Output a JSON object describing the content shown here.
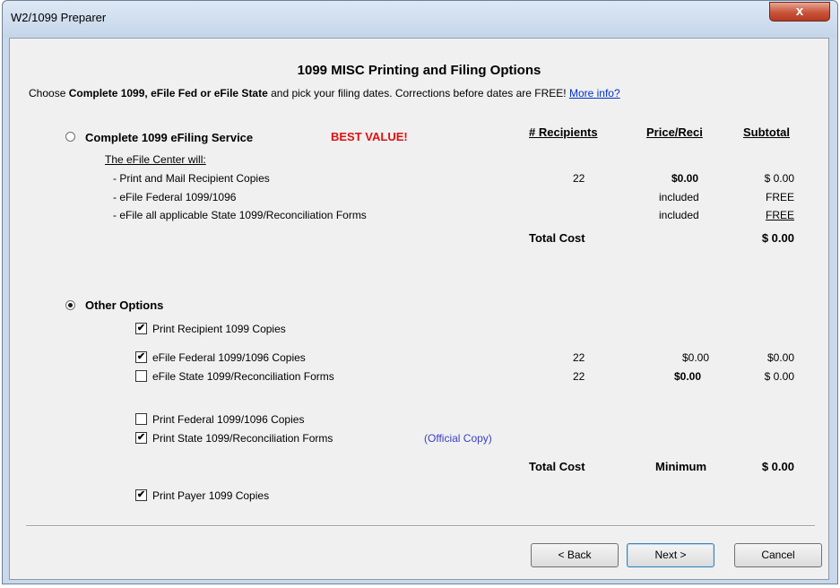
{
  "window": {
    "title": "W2/1099 Preparer",
    "close_glyph": "x"
  },
  "header": {
    "heading": "1099 MISC Printing and Filing Options",
    "sub_prefix": "Choose ",
    "sub_bold": "Complete 1099, eFile Fed or eFile State",
    "sub_rest": " and pick your filing dates. Corrections before dates are FREE! ",
    "more_info": "More info?"
  },
  "columns": {
    "recipients": "# Recipients",
    "price": "Price/Reci",
    "subtotal": "Subtotal"
  },
  "complete_service": {
    "label": "Complete 1099 eFiling Service",
    "best_value": "BEST VALUE!",
    "selected": false,
    "intro": "The eFile Center will:",
    "items": [
      {
        "text": "- Print and Mail Recipient Copies",
        "recipients": "22",
        "price": "$0.00",
        "subtotal": "$ 0.00"
      },
      {
        "text": "- eFile Federal 1099/1096",
        "recipients": "",
        "price": "included",
        "subtotal": "FREE"
      },
      {
        "text": "- eFile all applicable State 1099/Reconciliation Forms",
        "recipients": "",
        "price": "included",
        "subtotal": "FREE"
      }
    ],
    "total_label": "Total Cost",
    "total_value": "$ 0.00"
  },
  "other_options": {
    "label": "Other Options",
    "selected": true,
    "items": [
      {
        "label": "Print Recipient 1099 Copies",
        "checked": true
      },
      {
        "label": "eFile Federal 1099/1096 Copies",
        "checked": true,
        "recipients": "22",
        "price": "$0.00",
        "subtotal": "$0.00"
      },
      {
        "label": "eFile State 1099/Reconciliation Forms",
        "checked": false,
        "recipients": "22",
        "price": "$0.00",
        "subtotal": "$ 0.00"
      },
      {
        "label": "Print Federal 1099/1096 Copies",
        "checked": false
      },
      {
        "label": "Print State 1099/Reconciliation Forms",
        "checked": true,
        "note": "(Official Copy)"
      },
      {
        "label": "Print Payer 1099 Copies",
        "checked": true
      }
    ],
    "total_label": "Total Cost",
    "minimum_label": "Minimum",
    "total_value": "$ 0.00"
  },
  "buttons": {
    "back": "< Back",
    "next": "Next >",
    "cancel": "Cancel"
  },
  "check_glyph": "✔"
}
